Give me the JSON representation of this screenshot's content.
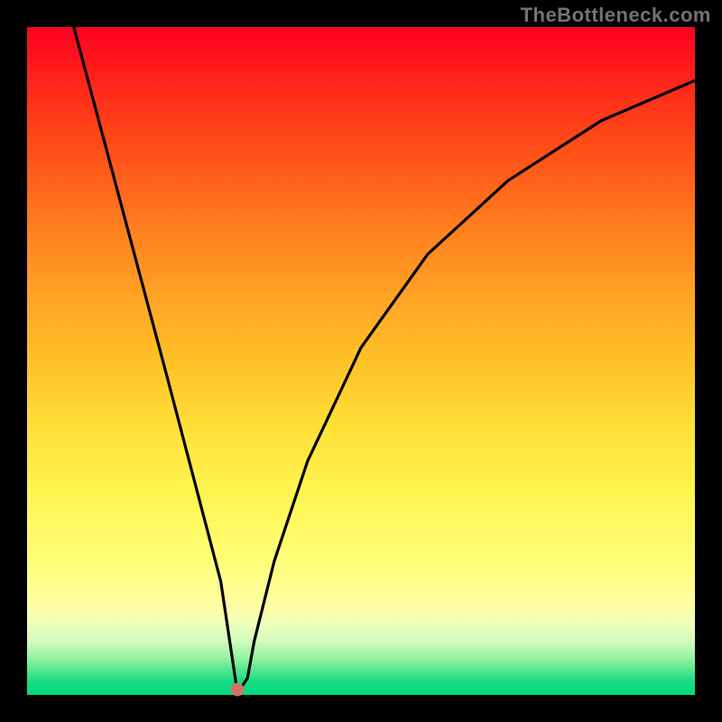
{
  "watermark": "TheBottleneck.com",
  "dot": {
    "x_percent": 31.5,
    "y_percent": 99.2
  },
  "chart_data": {
    "type": "line",
    "title": "",
    "xlabel": "",
    "ylabel": "",
    "xlim": [
      0,
      100
    ],
    "ylim": [
      0,
      100
    ],
    "series": [
      {
        "name": "bottleneck-curve",
        "x": [
          7,
          21,
          29,
          30.5,
          31.5,
          33,
          34,
          37,
          42,
          50,
          60,
          72,
          86,
          100
        ],
        "values": [
          100,
          47.5,
          17,
          7,
          0.3,
          2.5,
          8,
          20,
          35,
          52,
          66,
          77,
          86,
          92
        ]
      }
    ],
    "marker": {
      "x": 31.5,
      "y": 0.8
    },
    "grid": false,
    "legend": false
  }
}
